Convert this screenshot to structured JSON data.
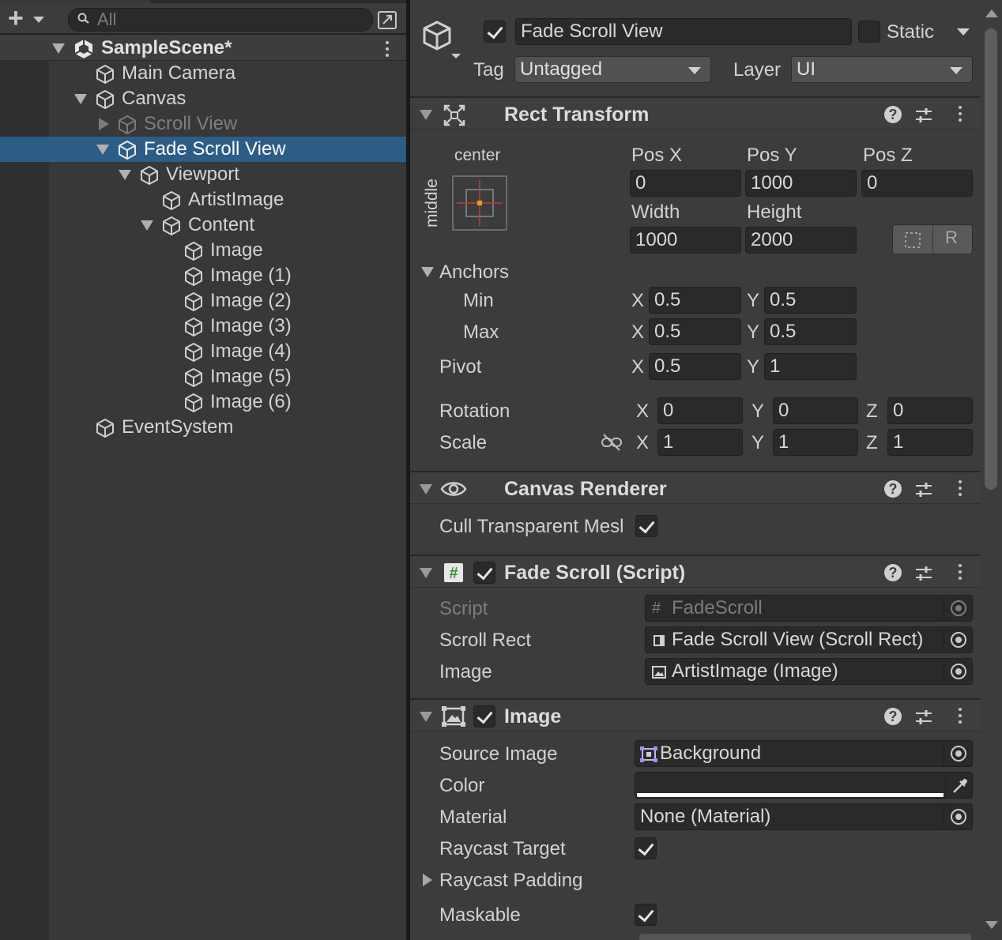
{
  "hierarchy": {
    "search_placeholder": "All",
    "scene": "SampleScene*",
    "items": [
      {
        "label": "Main Camera"
      },
      {
        "label": "Canvas"
      },
      {
        "label": "Scroll View"
      },
      {
        "label": "Fade Scroll View"
      },
      {
        "label": "Viewport"
      },
      {
        "label": "ArtistImage"
      },
      {
        "label": "Content"
      },
      {
        "label": "Image"
      },
      {
        "label": "Image (1)"
      },
      {
        "label": "Image (2)"
      },
      {
        "label": "Image (3)"
      },
      {
        "label": "Image (4)"
      },
      {
        "label": "Image (5)"
      },
      {
        "label": "Image (6)"
      },
      {
        "label": "EventSystem"
      }
    ]
  },
  "inspector": {
    "object_name": "Fade Scroll View",
    "static_label": "Static",
    "tag_label": "Tag",
    "tag_value": "Untagged",
    "layer_label": "Layer",
    "layer_value": "UI",
    "rect_transform": {
      "title": "Rect Transform",
      "anchor_h": "center",
      "anchor_v": "middle",
      "pos_x_label": "Pos X",
      "pos_x": "0",
      "pos_y_label": "Pos Y",
      "pos_y": "1000",
      "pos_z_label": "Pos Z",
      "pos_z": "0",
      "width_label": "Width",
      "width": "1000",
      "height_label": "Height",
      "height": "2000",
      "raw_button": "R",
      "anchors_label": "Anchors",
      "min_label": "Min",
      "min_x": "0.5",
      "min_y": "0.5",
      "max_label": "Max",
      "max_x": "0.5",
      "max_y": "0.5",
      "pivot_label": "Pivot",
      "pivot_x": "0.5",
      "pivot_y": "1",
      "rotation_label": "Rotation",
      "rot_x": "0",
      "rot_y": "0",
      "rot_z": "0",
      "scale_label": "Scale",
      "scale_x": "1",
      "scale_y": "1",
      "scale_z": "1",
      "axis_x": "X",
      "axis_y": "Y",
      "axis_z": "Z"
    },
    "canvas_renderer": {
      "title": "Canvas Renderer",
      "cull_label": "Cull Transparent Mesl"
    },
    "fade_scroll": {
      "title": "Fade Scroll (Script)",
      "script_label": "Script",
      "script_value": "FadeScroll",
      "scroll_rect_label": "Scroll Rect",
      "scroll_rect_value": "Fade Scroll View (Scroll Rect)",
      "image_label": "Image",
      "image_value": "ArtistImage (Image)"
    },
    "image": {
      "title": "Image",
      "source_label": "Source Image",
      "source_value": "Background",
      "color_label": "Color",
      "material_label": "Material",
      "material_value": "None (Material)",
      "raycast_target_label": "Raycast Target",
      "raycast_padding_label": "Raycast Padding",
      "maskable_label": "Maskable"
    }
  },
  "colors": {
    "selection": "#2c5d87",
    "panel": "#3c3c3c",
    "field": "#2a2a2a"
  }
}
